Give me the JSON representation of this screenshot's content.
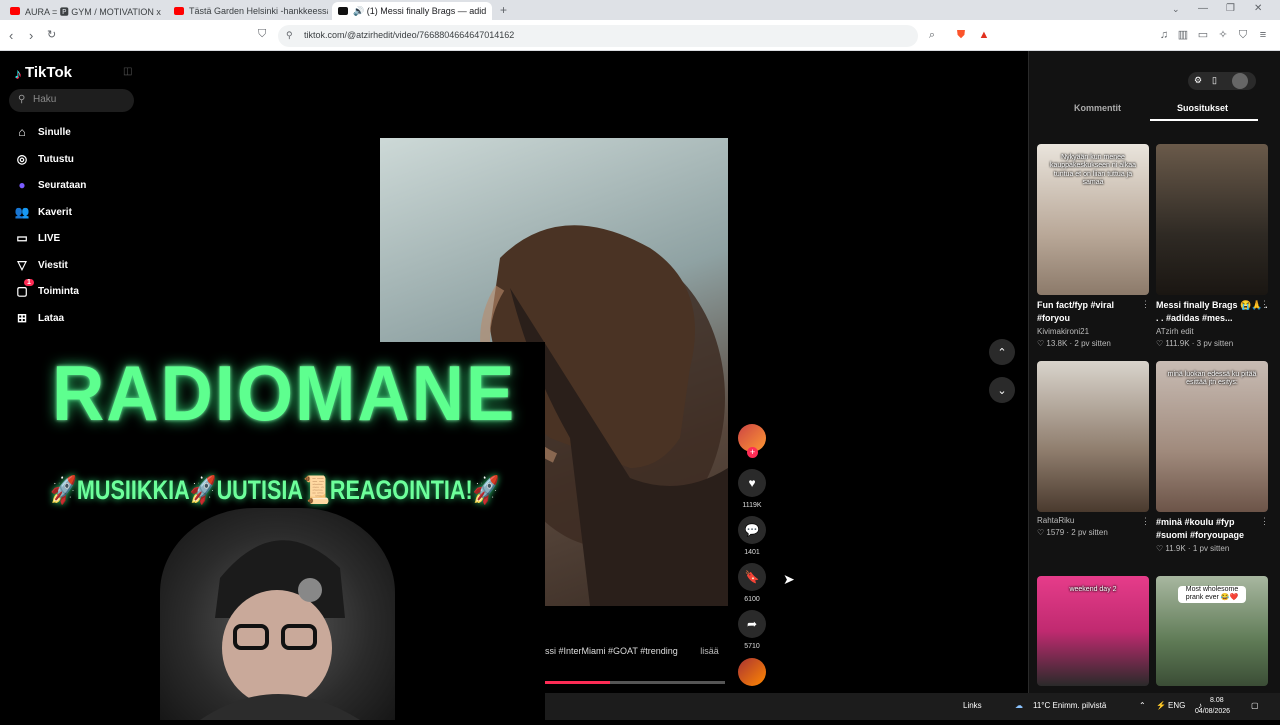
{
  "browser": {
    "tabs": [
      {
        "label": "AURA = 🅿 GYM / MOTIVATION x Eb",
        "favicon_color": "#ff0000"
      },
      {
        "label": "Tästä Garden Helsinki -hankkeessa on",
        "favicon_color": "#ff0000"
      },
      {
        "label": "🔊 (1) Messi finally Brags — adid",
        "favicon_color": "#111111"
      }
    ],
    "new_tab": "+",
    "url": "tiktok.com/@atzirhedit/video/7668804664647014162"
  },
  "tiktok": {
    "logo": "TikTok",
    "search_placeholder": "Haku",
    "nav": [
      {
        "label": "Sinulle",
        "icon": "home-icon",
        "glyph": "⌂"
      },
      {
        "label": "Tutustu",
        "icon": "compass-icon",
        "glyph": "◎"
      },
      {
        "label": "Seurataan",
        "icon": "following-avatar-icon",
        "glyph": "●"
      },
      {
        "label": "Kaverit",
        "icon": "friends-icon",
        "glyph": "👥"
      },
      {
        "label": "LIVE",
        "icon": "live-icon",
        "glyph": "▭"
      },
      {
        "label": "Viestit",
        "icon": "messages-icon",
        "glyph": "▽"
      },
      {
        "label": "Toiminta",
        "icon": "activity-icon",
        "glyph": "▢",
        "badge": "1"
      },
      {
        "label": "Lataa",
        "icon": "upload-icon",
        "glyph": "⊞"
      }
    ],
    "video": {
      "likes": "1119K",
      "comments": "1401",
      "saves": "6100",
      "shares": "5710",
      "caption": "ssi #InterMiami #GOAT #trending",
      "caption_more": "lisää",
      "progress": 0.36
    }
  },
  "overlay": {
    "title": "RADIOMANE",
    "subtitle": "🚀MUSIIKKIA🚀UUTISIA📜REAGOINTIA!🚀"
  },
  "right_panel": {
    "tabs": [
      "Kommentit",
      "Suositukset"
    ],
    "active_tab": "Suositukset",
    "videos": [
      {
        "overlay_text": "Nykyään kun menee kauppakeskukseen ni alkaa tuntua et on liian tuttua ja samaa",
        "caption": "Fun fact/fyp #viral #foryou",
        "author": "Kivimakironi21",
        "stats": "♡ 13.8K · 2 pv sitten",
        "bg": "linear-gradient(180deg,#e9e4dc,#b9a898 60%,#8c7a6a)"
      },
      {
        "overlay_text": "",
        "caption": "Messi finally Brags 😭🙏 . . . #adidas #mes...",
        "author": "ATzirh edit",
        "stats": "♡ 111.9K · 3 pv sitten",
        "bg": "linear-gradient(180deg,#6a5a4a,#2f2a24 60%,#1a1612)"
      },
      {
        "overlay_text": "",
        "caption": "",
        "author": "RahtaRiku",
        "stats": "♡ 1579 · 2 pv sitten",
        "bg": "linear-gradient(180deg,#d9d4cc,#8e7c6c 60%,#4a3a2e)"
      },
      {
        "overlay_text": "minä luokan edessä ku pitää esittää jtn esitys:",
        "caption": "#minä #koulu #fyp #suomi #foryoupage",
        "author": "",
        "stats": "♡ 11.9K · 1 pv sitten",
        "bg": "linear-gradient(180deg,#c8bcb4,#a08a7c 60%,#6c5448)"
      },
      {
        "overlay_text": "weekend day 2",
        "caption": "",
        "author": "",
        "stats": "",
        "bg": "linear-gradient(180deg,#e63c8a,#c02a70 50%,#2a2a2a)"
      },
      {
        "overlay_text": "Most wholesome prank ever 😂❤️",
        "caption": "",
        "author": "",
        "stats": "",
        "bg": "linear-gradient(180deg,#a8b7a0,#5e7a55 60%,#3b4d36)"
      }
    ]
  },
  "taskbar": {
    "links": "Links",
    "weather": "11°C  Enimm. pilvistä",
    "lang": "ENG",
    "time": "8.08",
    "date": "04/08/2026"
  }
}
